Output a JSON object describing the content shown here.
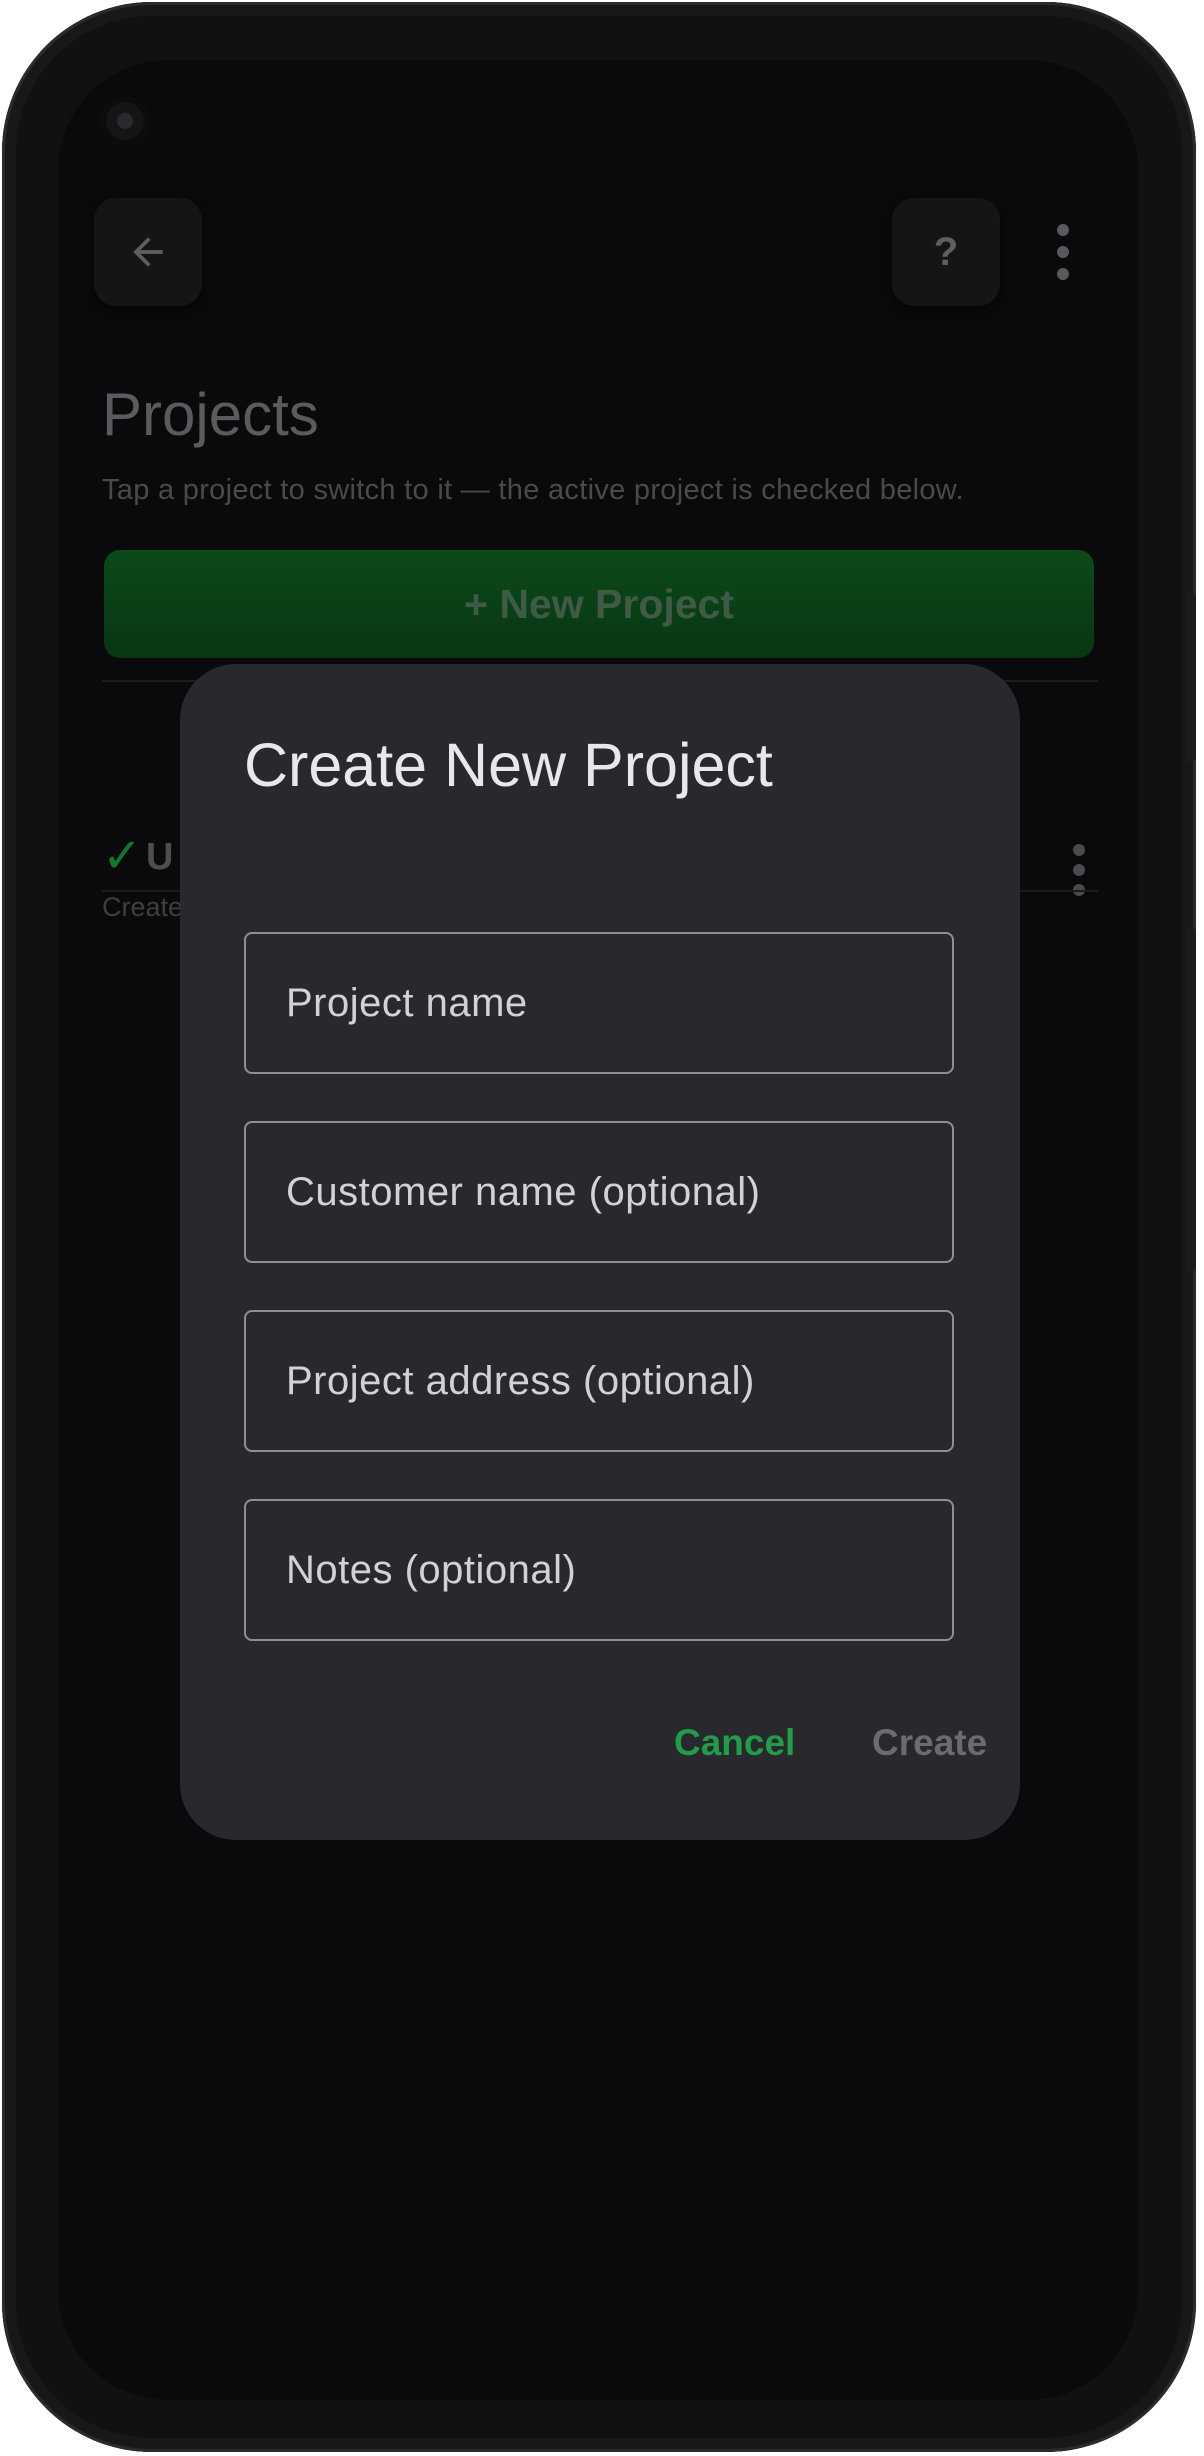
{
  "header": {
    "title": "Projects",
    "subtitle": "Tap a project to switch to it — the active project is checked below.",
    "help_label": "?"
  },
  "actions": {
    "new_project_label": "+ New Project"
  },
  "project_list": {
    "items": [
      {
        "check": "✓",
        "name": "U",
        "meta": "Create"
      }
    ]
  },
  "dialog": {
    "title": "Create New Project",
    "fields": {
      "project_name": {
        "placeholder": "Project name",
        "value": ""
      },
      "customer_name": {
        "placeholder": "Customer name (optional)",
        "value": ""
      },
      "project_address": {
        "placeholder": "Project address (optional)",
        "value": ""
      },
      "notes": {
        "placeholder": "Notes (optional)",
        "value": ""
      }
    },
    "cancel_label": "Cancel",
    "create_label": "Create"
  },
  "colors": {
    "accent_green": "#1f9d48",
    "dialog_bg": "#29292d",
    "screen_bg": "#0a0a0c"
  },
  "icons": [
    "back-arrow-icon",
    "help-icon",
    "more-vert-icon",
    "checkmark-icon"
  ]
}
